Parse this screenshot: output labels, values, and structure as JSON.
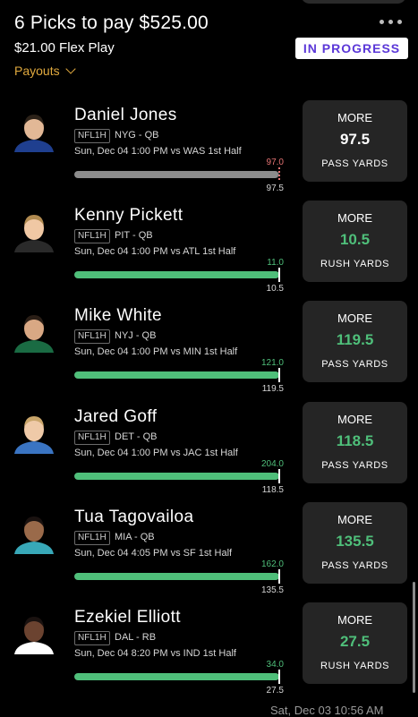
{
  "header": {
    "title": "6 Picks to pay $525.00",
    "subtitle": "$21.00 Flex Play",
    "status": "IN PROGRESS",
    "payouts_label": "Payouts"
  },
  "picks": [
    {
      "name": "Daniel Jones",
      "league": "NFL1H",
      "team_pos": "NYG - QB",
      "game": "Sun, Dec 04 1:00 PM  vs WAS 1st Half",
      "actual": "97.0",
      "line": "97.5",
      "direction": "MORE",
      "stat": "PASS YARDS",
      "progress": 0.995,
      "status": "losing"
    },
    {
      "name": "Kenny Pickett",
      "league": "NFL1H",
      "team_pos": "PIT - QB",
      "game": "Sun, Dec 04 1:00 PM  vs ATL 1st Half",
      "actual": "11.0",
      "line": "10.5",
      "direction": "MORE",
      "stat": "RUSH YARDS",
      "progress": 1.0,
      "status": "hit"
    },
    {
      "name": "Mike White",
      "league": "NFL1H",
      "team_pos": "NYJ - QB",
      "game": "Sun, Dec 04 1:00 PM  vs MIN 1st Half",
      "actual": "121.0",
      "line": "119.5",
      "direction": "MORE",
      "stat": "PASS YARDS",
      "progress": 1.0,
      "status": "hit"
    },
    {
      "name": "Jared Goff",
      "league": "NFL1H",
      "team_pos": "DET - QB",
      "game": "Sun, Dec 04 1:00 PM  vs JAC 1st Half",
      "actual": "204.0",
      "line": "118.5",
      "direction": "MORE",
      "stat": "PASS YARDS",
      "progress": 1.0,
      "status": "hit"
    },
    {
      "name": "Tua Tagovailoa",
      "league": "NFL1H",
      "team_pos": "MIA - QB",
      "game": "Sun, Dec 04 4:05 PM  vs SF 1st Half",
      "actual": "162.0",
      "line": "135.5",
      "direction": "MORE",
      "stat": "PASS YARDS",
      "progress": 1.0,
      "status": "hit"
    },
    {
      "name": "Ezekiel Elliott",
      "league": "NFL1H",
      "team_pos": "DAL - RB",
      "game": "Sun, Dec 04 8:20 PM  vs IND 1st Half",
      "actual": "34.0",
      "line": "27.5",
      "direction": "MORE",
      "stat": "RUSH YARDS",
      "progress": 1.0,
      "status": "hit"
    }
  ],
  "footer": {
    "timestamp": "Sat, Dec 03 10:56 AM"
  },
  "colors": {
    "hit": "#4fbf7a",
    "losing_bar": "#8c8c8c",
    "losing_value": "#e57373",
    "accent_badge_text": "#5b37d8",
    "payouts": "#e0a93e",
    "card_bg": "#252525"
  },
  "icons": [
    "more-dots-icon",
    "chevron-down-icon",
    "player-headshot"
  ]
}
